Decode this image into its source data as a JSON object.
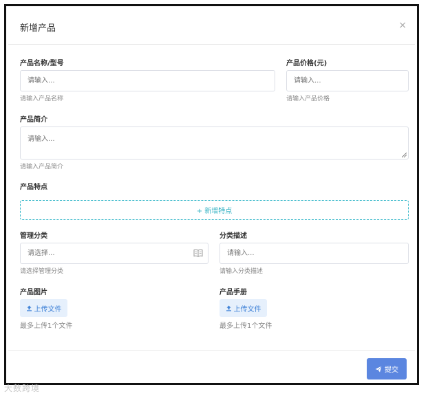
{
  "dialog": {
    "title": "新增产品",
    "close_glyph": "×"
  },
  "form": {
    "name": {
      "label": "产品名称/型号",
      "placeholder": "请输入...",
      "hint": "请输入产品名称"
    },
    "price": {
      "label": "产品价格(元)",
      "placeholder": "请输入...",
      "hint": "请输入产品价格"
    },
    "intro": {
      "label": "产品简介",
      "placeholder": "请输入...",
      "hint": "请输入产品简介"
    },
    "features": {
      "label": "产品特点",
      "add_label": "+ 新增特点"
    },
    "category": {
      "label": "管理分类",
      "placeholder": "请选择...",
      "hint": "请选择管理分类",
      "icon": "book-icon"
    },
    "category_desc": {
      "label": "分类描述",
      "placeholder": "请输入...",
      "hint": "请输入分类描述"
    },
    "image": {
      "label": "产品图片",
      "upload_label": "上传文件",
      "hint": "最多上传1个文件"
    },
    "manual": {
      "label": "产品手册",
      "upload_label": "上传文件",
      "hint": "最多上传1个文件"
    }
  },
  "footer": {
    "submit_label": "提交",
    "submit_icon": "send-icon"
  },
  "watermark": "大数跨境",
  "colors": {
    "accent": "#5b86e0",
    "dashed": "#35b7c9",
    "upload_bg": "#e6f0fc",
    "upload_text": "#3b7fd6"
  }
}
